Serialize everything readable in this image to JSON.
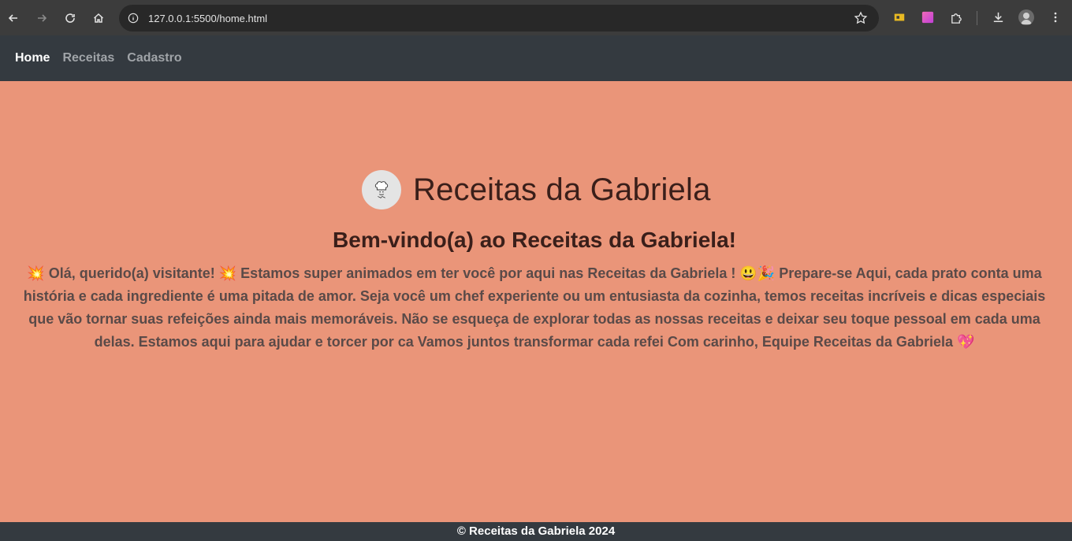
{
  "browser": {
    "url": "127.0.0.1:5500/home.html",
    "icons": [
      "back-arrow-icon",
      "forward-arrow-icon",
      "reload-icon",
      "home-icon",
      "site-info-icon",
      "bookmark-star-icon",
      "extension-icon",
      "puzzle-icon",
      "download-icon",
      "profile-avatar",
      "more-menu-icon"
    ]
  },
  "nav": {
    "items": [
      "Home",
      "Receitas",
      "Cadastro"
    ],
    "active": "Home"
  },
  "hero": {
    "title": "Receitas da Gabriela",
    "subtitle": "Bem-vindo(a) ao Receitas da Gabriela!",
    "message": "💥 Olá, querido(a) visitante! 💥 Estamos super animados em ter você por aqui nas Receitas da Gabriela ! 😃🎉 Prepare-se Aqui, cada prato conta uma história e cada ingrediente é uma pitada de amor. Seja você um chef experiente ou um entusiasta da cozinha, temos receitas incríveis e dicas especiais que vão tornar suas refeições ainda mais memoráveis. Não se esqueça de explorar todas as nossas receitas e deixar seu toque pessoal em cada uma delas. Estamos aqui para ajudar e torcer por ca Vamos juntos transformar cada refei Com carinho, Equipe Receitas da Gabriela 💖"
  },
  "footer": {
    "text": "© Receitas da Gabriela 2024"
  },
  "colors": {
    "page_background": "#ea9579",
    "navbar": "#343a40",
    "footer": "#343a40",
    "heading": "#3a1f1a",
    "message_text": "#5a4a48"
  }
}
